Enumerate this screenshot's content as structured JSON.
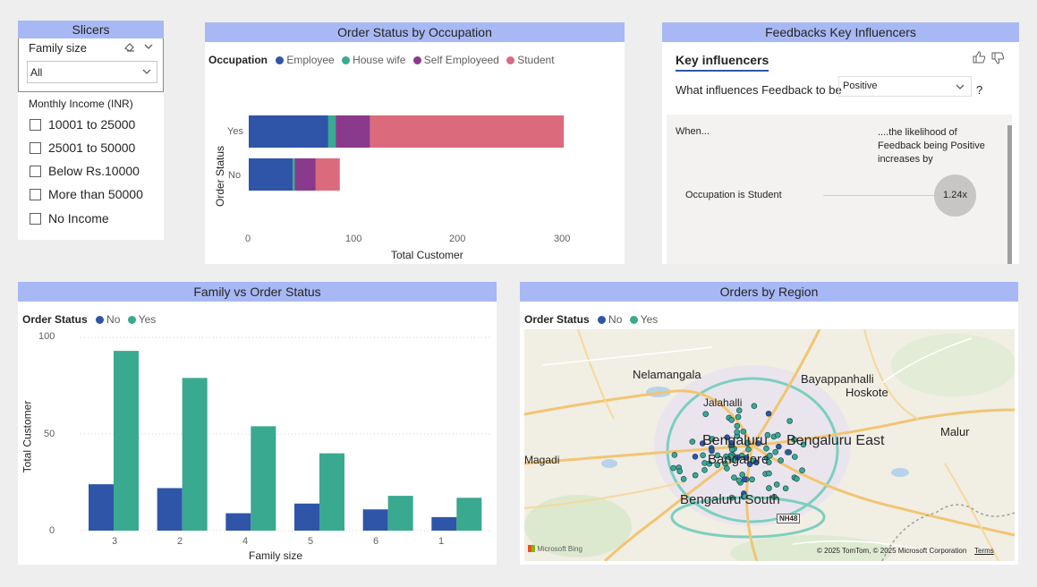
{
  "colors": {
    "title_bar": "#a8b8f4",
    "employee": "#2f55a8",
    "house_wife": "#39a98f",
    "self_employeed": "#8a3a8c",
    "student": "#dc6a7d",
    "no": "#2f55a8",
    "yes": "#39a98f"
  },
  "slicers": {
    "title": "Slicers",
    "family_size_label": "Family size",
    "family_size_value": "All",
    "income_label": "Monthly Income (INR)",
    "income_options": [
      "10001 to 25000",
      "25001 to 50000",
      "Below Rs.10000",
      "More than 50000",
      "No Income"
    ]
  },
  "order_status_chart": {
    "title": "Order Status by Occupation",
    "legend_label": "Occupation",
    "xlabel": "Total Customer",
    "ylabel": "Order Status",
    "x_ticks": [
      "0",
      "100",
      "200",
      "300"
    ]
  },
  "key_influencers": {
    "title": "Feedbacks Key Influencers",
    "tab": "Key influencers",
    "question": "What influences Feedback to be",
    "selected_value": "Positive",
    "question_mark": "?",
    "when_label": "When...",
    "likelihood_text": "....the likelihood of Feedback being Positive increases by",
    "factor": "Occupation is Student",
    "factor_value": "1.24x"
  },
  "family_chart": {
    "title": "Family vs Order Status",
    "legend_label": "Order Status",
    "xlabel": "Family size",
    "ylabel": "Total Customer",
    "y_ticks": [
      "100",
      "50",
      "0"
    ]
  },
  "map": {
    "title": "Orders by Region",
    "legend_label": "Order Status",
    "legend_items": [
      "No",
      "Yes"
    ],
    "places": {
      "nelamangala": "Nelamangala",
      "bayappanhalli": "Bayappanhalli",
      "hoskote": "Hoskote",
      "jalahalli": "Jalahalli",
      "bengaluru": "Bengaluru",
      "bangalore": "Bangalore",
      "bengaluru_east": "Bengaluru East",
      "malur": "Malur",
      "magadi": "Magadi",
      "bengaluru_south": "Bengaluru South",
      "nh48": "NH48"
    },
    "brand": "Microsoft Bing",
    "copyright": "© 2025 TomTom, © 2025 Microsoft Corporation",
    "terms": "Terms"
  },
  "chart_data": [
    {
      "type": "bar",
      "orientation": "horizontal",
      "stacked": true,
      "title": "Order Status by Occupation",
      "categories": [
        "Yes",
        "No"
      ],
      "series": [
        {
          "name": "Employee",
          "values": [
            76,
            42
          ]
        },
        {
          "name": "House wife",
          "values": [
            7,
            2
          ]
        },
        {
          "name": "Self Employeed",
          "values": [
            33,
            20
          ]
        },
        {
          "name": "Student",
          "values": [
            185,
            23
          ]
        }
      ],
      "xlabel": "Total Customer",
      "ylabel": "Order Status",
      "xlim": [
        0,
        300
      ],
      "legend": "top-left"
    },
    {
      "type": "bar",
      "title": "Family vs Order Status",
      "categories": [
        "3",
        "2",
        "4",
        "5",
        "6",
        "1"
      ],
      "series": [
        {
          "name": "No",
          "values": [
            24,
            22,
            9,
            14,
            11,
            7
          ]
        },
        {
          "name": "Yes",
          "values": [
            93,
            79,
            54,
            40,
            18,
            17
          ]
        }
      ],
      "xlabel": "Family size",
      "ylabel": "Total Customer",
      "ylim": [
        0,
        100
      ],
      "grid": true,
      "legend": "top-left"
    }
  ]
}
